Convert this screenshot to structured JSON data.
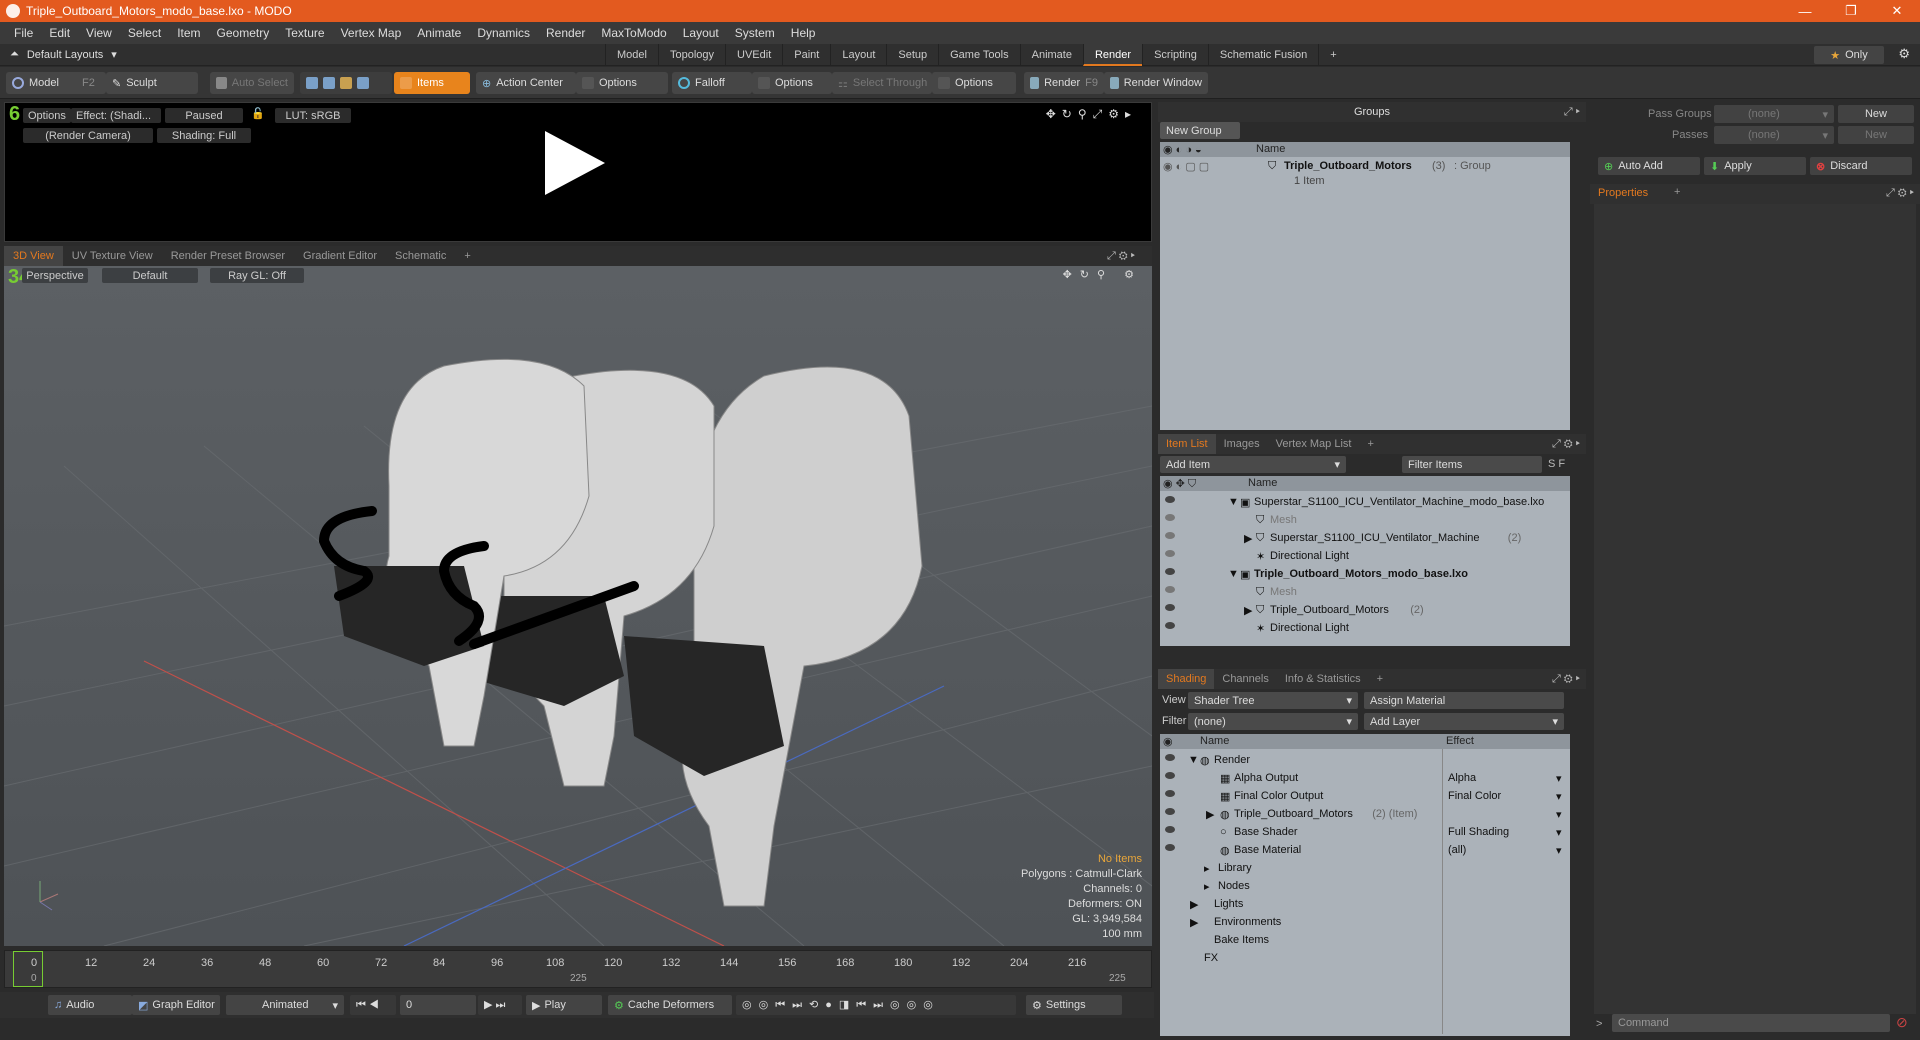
{
  "window": {
    "title": "Triple_Outboard_Motors_modo_base.lxo - MODO",
    "controls": [
      "—",
      "❐",
      "✕"
    ]
  },
  "menu": [
    "File",
    "Edit",
    "View",
    "Select",
    "Item",
    "Geometry",
    "Texture",
    "Vertex Map",
    "Animate",
    "Dynamics",
    "Render",
    "MaxToModo",
    "Layout",
    "System",
    "Help"
  ],
  "layouts": {
    "label": "Default Layouts",
    "tabs": [
      "Model",
      "Topology",
      "UVEdit",
      "Paint",
      "Layout",
      "Setup",
      "Game Tools",
      "Animate",
      "Render",
      "Scripting",
      "Schematic Fusion"
    ],
    "active": "Render",
    "only": "Only"
  },
  "toolbar": {
    "model": "Model",
    "model_key": "F2",
    "sculpt": "Sculpt",
    "auto_select": "Auto Select",
    "items": "Items",
    "action_center": "Action Center",
    "options": "Options",
    "falloff": "Falloff",
    "select_through": "Select Through",
    "render": "Render",
    "render_key": "F9",
    "render_window": "Render Window"
  },
  "preview": {
    "options": "Options",
    "effect": "Effect: (Shadi...",
    "paused": "Paused",
    "lut": "LUT: sRGB",
    "camera": "(Render Camera)",
    "shading": "Shading: Full",
    "frame_badge": "6"
  },
  "viewtabs": [
    "3D View",
    "UV Texture View",
    "Render Preset Browser",
    "Gradient Editor",
    "Schematic"
  ],
  "viewport": {
    "perspective": "Perspective",
    "default": "Default",
    "raygl": "Ray GL: Off",
    "badge": "34",
    "info": {
      "no_items": "No Items",
      "polygons": "Polygons : Catmull-Clark",
      "channels": "Channels: 0",
      "deformers": "Deformers: ON",
      "gl": "GL: 3,949,584",
      "scale": "100 mm"
    }
  },
  "timeline": {
    "ticks": [
      "12",
      "24",
      "36",
      "48",
      "60",
      "72",
      "84",
      "96",
      "108",
      "120",
      "132",
      "144",
      "156",
      "168",
      "180",
      "192",
      "204",
      "216"
    ],
    "start": "0",
    "end_a": "225",
    "end_b": "225"
  },
  "bottombar": {
    "audio": "Audio",
    "graph_editor": "Graph Editor",
    "animated": "Animated",
    "frame": "0",
    "play": "Play",
    "cache": "Cache Deformers",
    "settings": "Settings"
  },
  "groups": {
    "title": "Groups",
    "new_group": "New Group",
    "col_name": "Name",
    "item_name": "Triple_Outboard_Motors",
    "item_count": "(3)",
    "item_type": ": Group",
    "item_sub": "1 Item"
  },
  "itemlist": {
    "tabs": [
      "Item List",
      "Images",
      "Vertex Map List"
    ],
    "add_item": "Add Item",
    "filter": "Filter Items",
    "col_name": "Name",
    "rows": [
      {
        "label": "Superstar_S1100_ICU_Ventilator_Machine_modo_base.lxo",
        "indent": 0,
        "bold": false
      },
      {
        "label": "Mesh",
        "indent": 1,
        "bold": false,
        "dim": true
      },
      {
        "label": "Superstar_S1100_ICU_Ventilator_Machine",
        "count": "(2)",
        "indent": 1,
        "bold": false
      },
      {
        "label": "Directional Light",
        "indent": 1,
        "bold": false
      },
      {
        "label": "Triple_Outboard_Motors_modo_base.lxo",
        "indent": 0,
        "bold": true
      },
      {
        "label": "Mesh",
        "indent": 1,
        "bold": false,
        "dim": true
      },
      {
        "label": "Triple_Outboard_Motors",
        "count": "(2)",
        "indent": 1,
        "bold": false
      },
      {
        "label": "Directional Light",
        "indent": 1,
        "bold": false
      }
    ]
  },
  "shading": {
    "tabs": [
      "Shading",
      "Channels",
      "Info & Statistics"
    ],
    "view_label": "View",
    "view_value": "Shader Tree",
    "assign": "Assign Material",
    "filter_label": "Filter",
    "filter_value": "(none)",
    "add_layer": "Add Layer",
    "col_name": "Name",
    "col_effect": "Effect",
    "rows": [
      {
        "label": "Render",
        "effect": ""
      },
      {
        "label": "Alpha Output",
        "effect": "Alpha"
      },
      {
        "label": "Final Color Output",
        "effect": "Final Color"
      },
      {
        "label": "Triple_Outboard_Motors",
        "extra": "(2) (Item)",
        "effect": ""
      },
      {
        "label": "Base Shader",
        "effect": "Full Shading"
      },
      {
        "label": "Base Material",
        "effect": "(all)"
      },
      {
        "label": "Library",
        "effect": ""
      },
      {
        "label": "Nodes",
        "effect": ""
      },
      {
        "label": "Lights",
        "effect": ""
      },
      {
        "label": "Environments",
        "effect": ""
      },
      {
        "label": "Bake Items",
        "effect": ""
      },
      {
        "label": "FX",
        "effect": ""
      }
    ]
  },
  "passes": {
    "pass_groups": "Pass Groups",
    "passes": "Passes",
    "none": "(none)",
    "new": "New",
    "auto_add": "Auto Add",
    "apply": "Apply",
    "discard": "Discard",
    "properties": "Properties",
    "command": "Command"
  }
}
